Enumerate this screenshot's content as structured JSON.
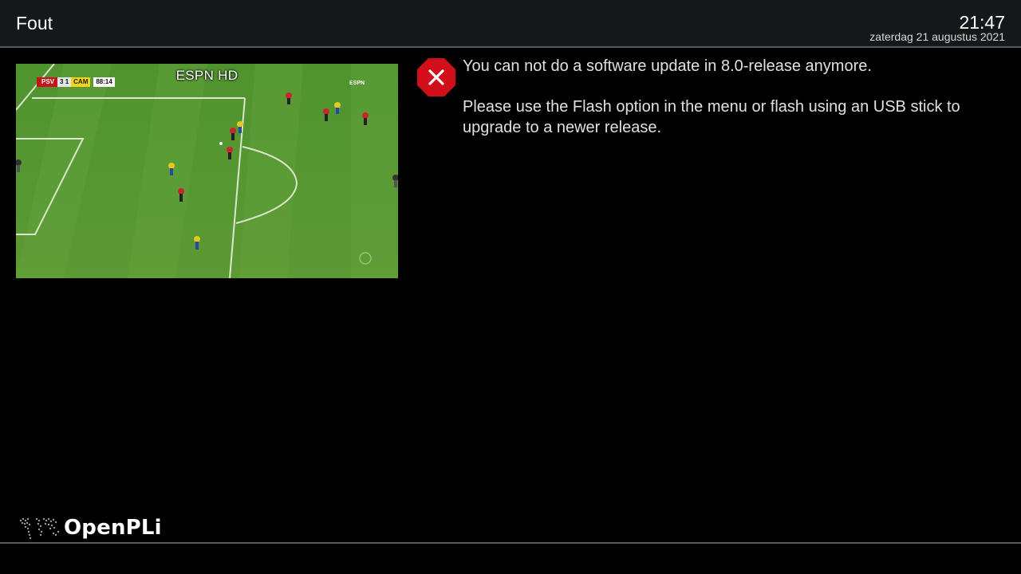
{
  "header": {
    "title": "Fout",
    "clock": "21:47",
    "date": "zaterdag 21 augustus 2021"
  },
  "pip": {
    "channel": "ESPN HD",
    "scorebug": {
      "home_team": "PSV",
      "score": "3  1",
      "away_team": "CAM",
      "match_time": "88:14"
    },
    "broadcaster_logo": "ESPN"
  },
  "message": {
    "icon": "error-x-icon",
    "icon_color": "#d10f1b",
    "line1": "You can not do a software update in 8.0-release anymore.",
    "line2": "Please use the Flash option in the menu or flash using an USB stick to upgrade to a newer release."
  },
  "footer": {
    "logo_text": "OpenPLi",
    "logo_icon": "world-map-icon"
  }
}
